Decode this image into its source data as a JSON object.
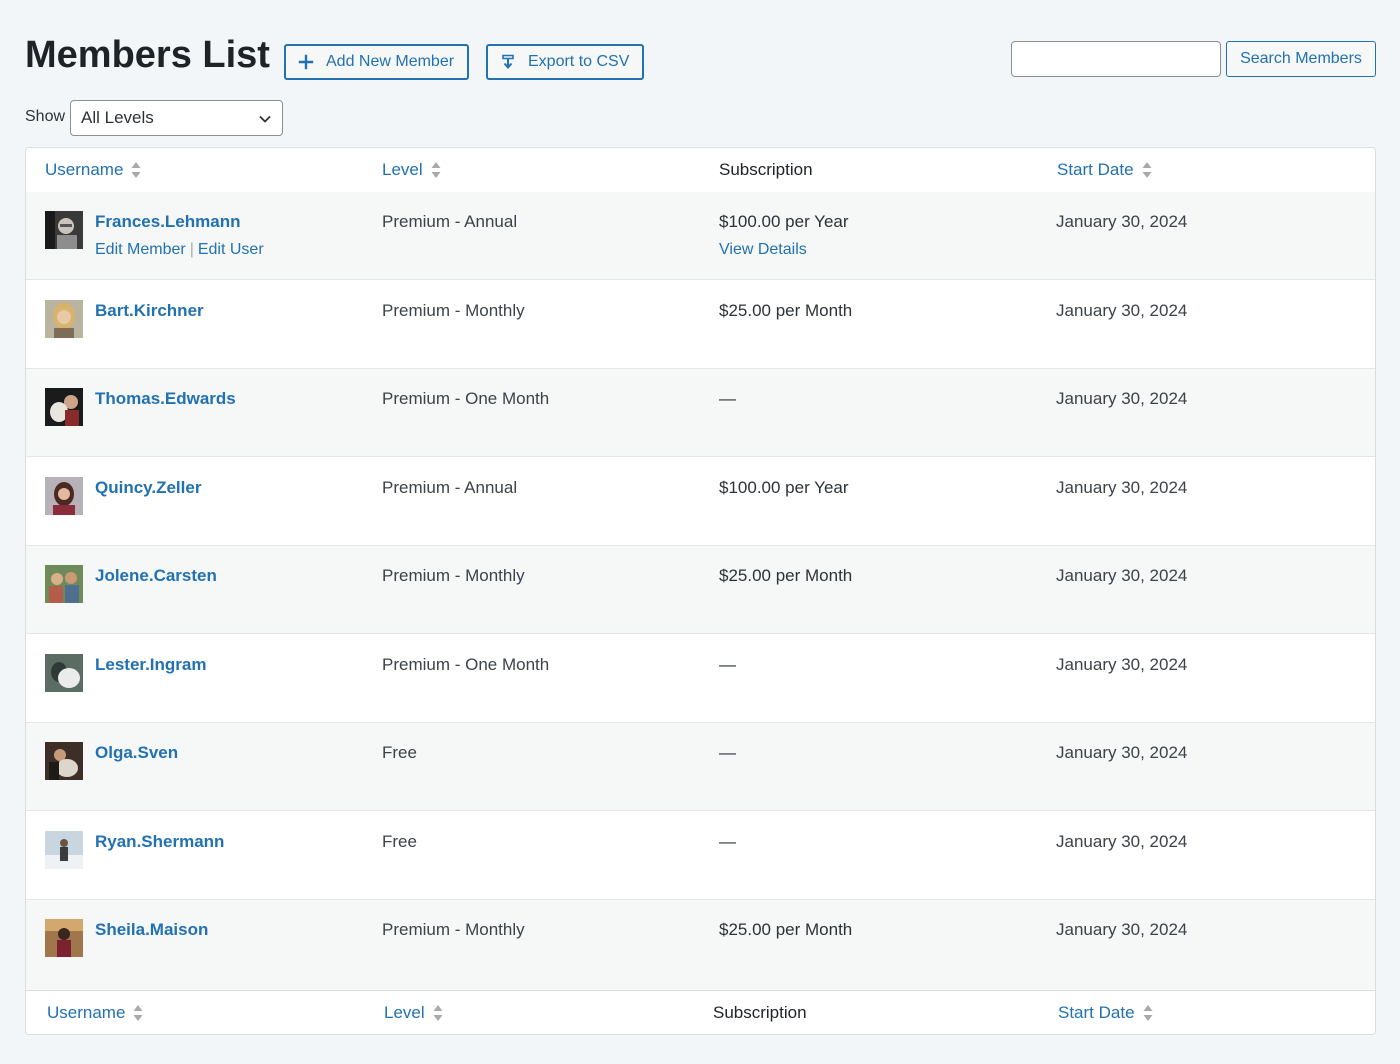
{
  "header": {
    "title": "Members List",
    "add_label": "Add New Member",
    "export_label": "Export to CSV",
    "search_value": "",
    "search_button": "Search Members"
  },
  "filter": {
    "show_label": "Show",
    "selected": "All Levels"
  },
  "table": {
    "columns": {
      "username": "Username",
      "level": "Level",
      "subscription": "Subscription",
      "start_date": "Start Date"
    },
    "row_actions": {
      "edit_member": "Edit Member",
      "separator": "|",
      "edit_user": "Edit User",
      "view_details": "View Details"
    },
    "rows": [
      {
        "username": "Frances.Lehmann",
        "level": "Premium - Annual",
        "subscription": "$100.00 per Year",
        "start_date": "January 30, 2024"
      },
      {
        "username": "Bart.Kirchner",
        "level": "Premium - Monthly",
        "subscription": "$25.00 per Month",
        "start_date": "January 30, 2024"
      },
      {
        "username": "Thomas.Edwards",
        "level": "Premium - One Month",
        "subscription": "—",
        "start_date": "January 30, 2024"
      },
      {
        "username": "Quincy.Zeller",
        "level": "Premium - Annual",
        "subscription": "$100.00 per Year",
        "start_date": "January 30, 2024"
      },
      {
        "username": "Jolene.Carsten",
        "level": "Premium - Monthly",
        "subscription": "$25.00 per Month",
        "start_date": "January 30, 2024"
      },
      {
        "username": "Lester.Ingram",
        "level": "Premium - One Month",
        "subscription": "—",
        "start_date": "January 30, 2024"
      },
      {
        "username": "Olga.Sven",
        "level": "Free",
        "subscription": "—",
        "start_date": "January 30, 2024"
      },
      {
        "username": "Ryan.Shermann",
        "level": "Free",
        "subscription": "—",
        "start_date": "January 30, 2024"
      },
      {
        "username": "Sheila.Maison",
        "level": "Premium - Monthly",
        "subscription": "$25.00 per Month",
        "start_date": "January 30, 2024"
      }
    ]
  },
  "colors": {
    "accent": "#2271b1",
    "background": "#f3f6f9",
    "title": "#1d2327"
  },
  "icons": {
    "add": "plus-icon",
    "export": "download-icon",
    "sort": "sort-arrows-icon",
    "select": "chevron-down-icon",
    "avatar": "user-photo"
  }
}
